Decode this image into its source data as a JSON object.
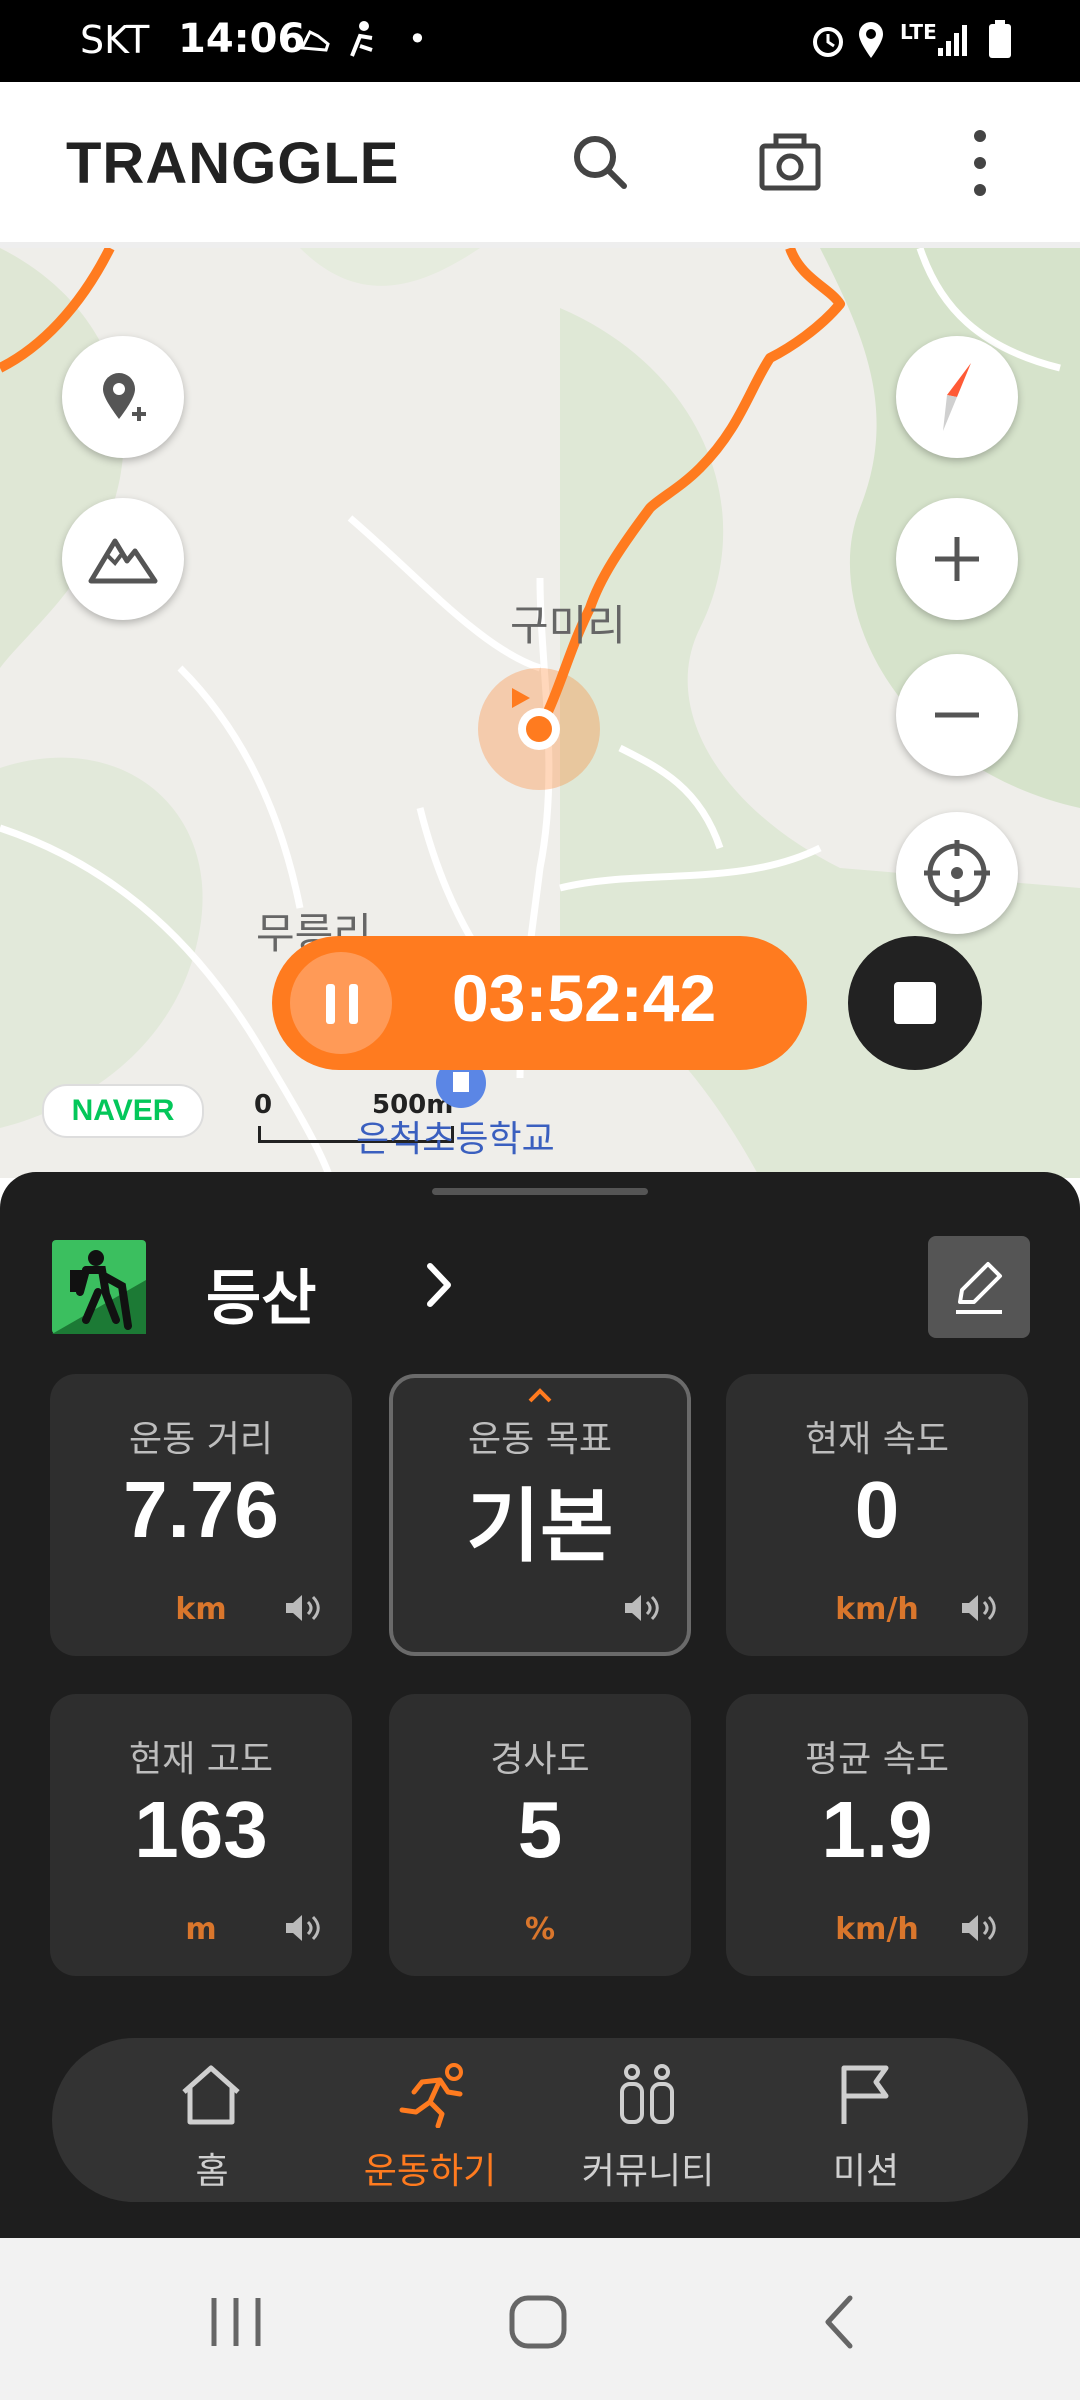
{
  "status_bar": {
    "carrier": "SKT",
    "time": "14:06",
    "network": "LTE"
  },
  "app_bar": {
    "logo": "TRANGGLE"
  },
  "map": {
    "labels": [
      "구미리",
      "무릉리",
      "은척초등학교"
    ],
    "naver_badge": "NAVER",
    "scale": {
      "start": "0",
      "end": "500m"
    }
  },
  "timer": {
    "elapsed": "03:52:42"
  },
  "activity": {
    "name": "등산"
  },
  "stats": [
    {
      "label": "운동 거리",
      "value": "7.76",
      "unit": "km",
      "sound": true
    },
    {
      "label": "운동 목표",
      "value": "기본",
      "unit": "",
      "sound": true,
      "selected": true
    },
    {
      "label": "현재 속도",
      "value": "0",
      "unit": "km/h",
      "sound": true
    },
    {
      "label": "현재 고도",
      "value": "163",
      "unit": "m",
      "sound": true
    },
    {
      "label": "경사도",
      "value": "5",
      "unit": "%",
      "sound": false
    },
    {
      "label": "평균 속도",
      "value": "1.9",
      "unit": "km/h",
      "sound": true
    }
  ],
  "bottom_nav": [
    {
      "label": "홈",
      "icon": "home-icon",
      "active": false
    },
    {
      "label": "운동하기",
      "icon": "running-icon",
      "active": true
    },
    {
      "label": "커뮤니티",
      "icon": "community-icon",
      "active": false
    },
    {
      "label": "미션",
      "icon": "flag-icon",
      "active": false
    }
  ],
  "colors": {
    "accent": "#ff7b1f",
    "sheet_bg": "#1e1e1e",
    "card_bg": "#2e2e2e",
    "unit": "#d9762c",
    "activity_icon_bg": "#3bbf5f"
  }
}
